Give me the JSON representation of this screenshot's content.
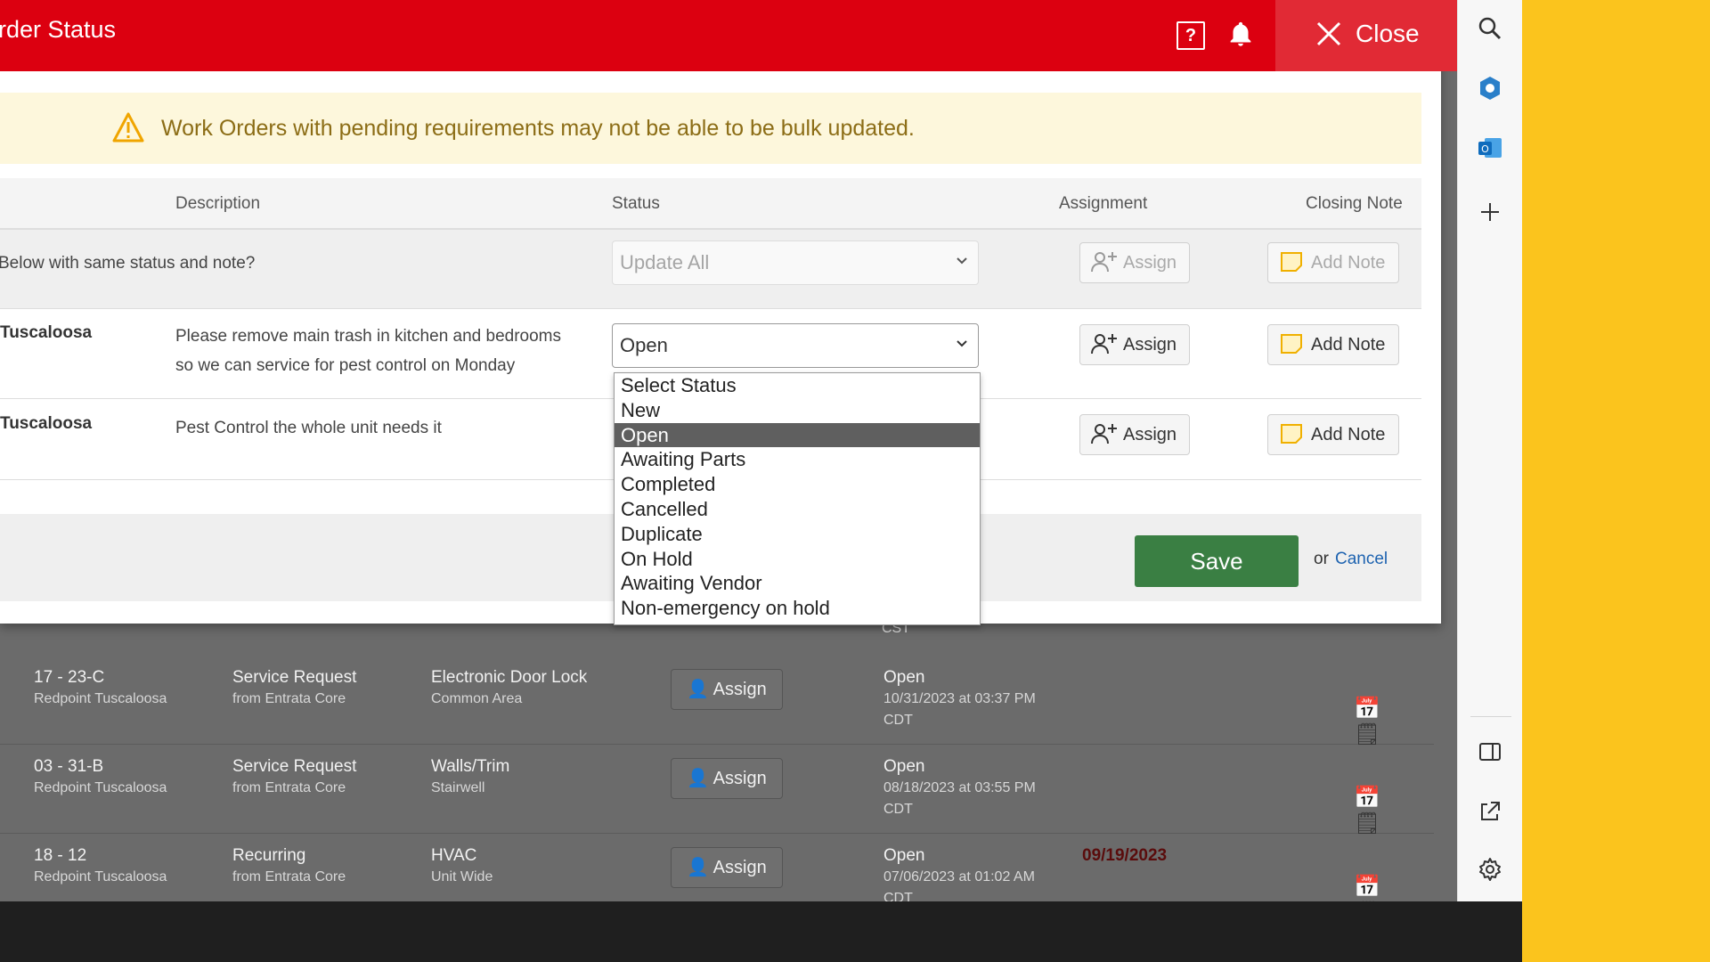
{
  "modal": {
    "title": "rder Status",
    "close_label": "Close",
    "warning": "Work Orders with pending requirements may not be able to be bulk updated.",
    "columns": {
      "description": "Description",
      "status": "Status",
      "assignment": "Assignment",
      "closing_note": "Closing Note"
    },
    "bulk_row": {
      "question": "Below with same status and note?",
      "status_placeholder": "Update All",
      "assign_label": "Assign",
      "note_label": "Add Note"
    },
    "rows": [
      {
        "property": "Tuscaloosa",
        "description_line1": "Please remove main trash in kitchen and bedrooms",
        "description_line2": "so we can service for pest control on Monday",
        "status": "Open",
        "assign_label": "Assign",
        "note_label": "Add Note"
      },
      {
        "property": "Tuscaloosa",
        "description_line1": "Pest Control the whole unit needs it",
        "assign_label": "Assign",
        "note_label": "Add Note"
      }
    ],
    "status_options": [
      "Select Status",
      "New",
      "Open",
      "Awaiting Parts",
      "Completed",
      "Cancelled",
      "Duplicate",
      "On Hold",
      "Awaiting Vendor",
      "Non-emergency on hold"
    ],
    "selected_status": "Open",
    "footer": {
      "save_label": "Save",
      "or_text": "or",
      "cancel_label": "Cancel"
    }
  },
  "background_list": {
    "partial_text": "CST",
    "rows": [
      {
        "unit": "17 - 23-C",
        "property": "Redpoint Tuscaloosa",
        "type": "Service Request",
        "source": "from Entrata Core",
        "category": "Electronic Door Lock",
        "location": "Common Area",
        "assign_label": "Assign",
        "status": "Open",
        "date": "10/31/2023 at 03:37 PM",
        "tz": "CDT",
        "due": ""
      },
      {
        "unit": "03 - 31-B",
        "property": "Redpoint Tuscaloosa",
        "type": "Service Request",
        "source": "from Entrata Core",
        "category": "Walls/Trim",
        "location": "Stairwell",
        "assign_label": "Assign",
        "status": "Open",
        "date": "08/18/2023 at 03:55 PM",
        "tz": "CDT",
        "due": ""
      },
      {
        "unit": "18 - 12",
        "property": "Redpoint Tuscaloosa",
        "type": "Recurring",
        "source": "from Entrata Core",
        "category": "HVAC",
        "location": "Unit Wide",
        "assign_label": "Assign",
        "status": "Open",
        "date": "07/06/2023 at 01:02 AM",
        "tz": "CDT",
        "due": "09/19/2023"
      }
    ]
  },
  "colors": {
    "header_red": "#dc0010",
    "save_green": "#3a7f43",
    "warning_bg": "#fdf7dc",
    "link_blue": "#1e63b0",
    "desktop_yellow": "#fbc41d"
  },
  "icons": [
    "help-icon",
    "bell-icon",
    "close-icon",
    "warning-icon",
    "chevron-down-icon",
    "add-user-icon",
    "note-icon",
    "calendar-icon",
    "search-icon",
    "copilot-icon",
    "outlook-icon",
    "plus-icon",
    "split-screen-icon",
    "external-link-icon",
    "gear-icon"
  ]
}
